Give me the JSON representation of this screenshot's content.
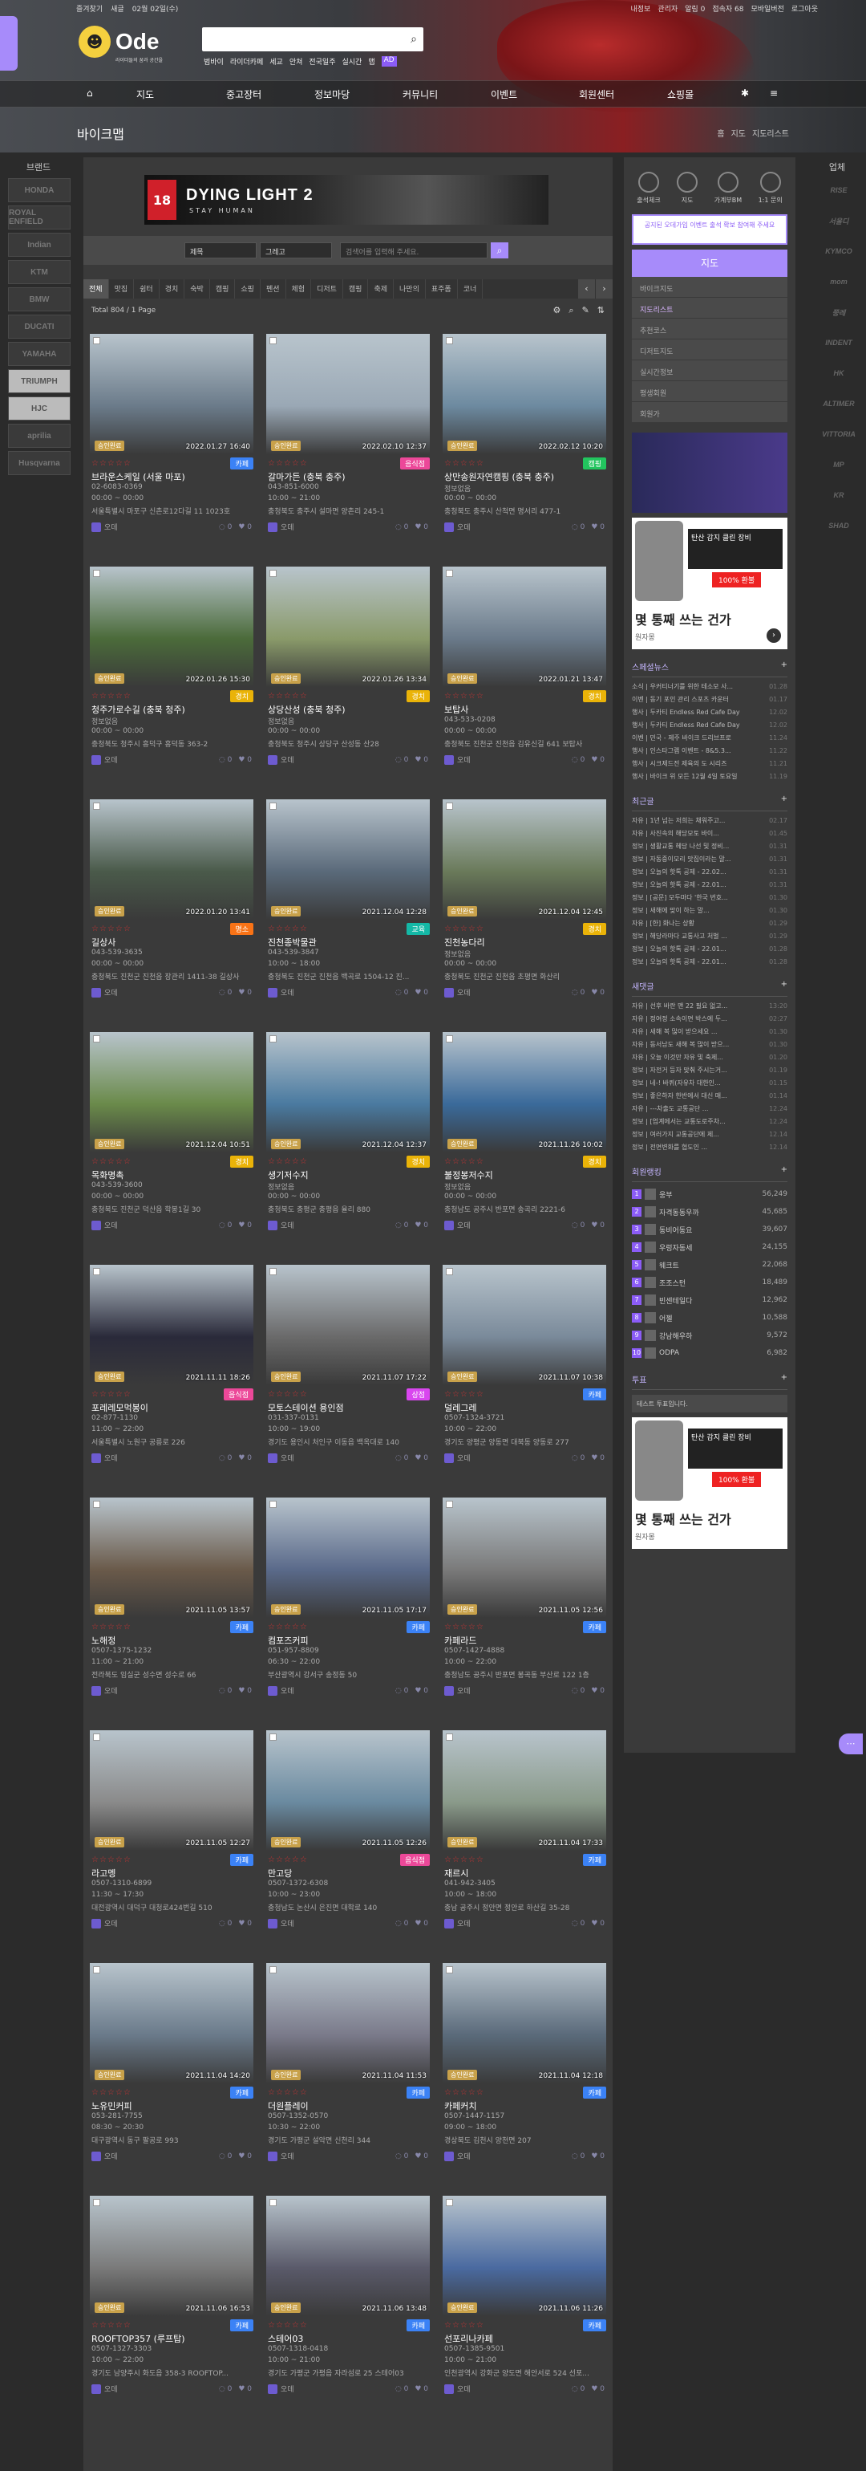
{
  "topbar": {
    "left": [
      "즐겨찾기",
      "새글",
      "02월 02일(수)"
    ],
    "right": [
      "내정보",
      "관리자",
      "알림 0",
      "접속자 68",
      "모바일버전",
      "로그아웃"
    ]
  },
  "logo": {
    "text": "Ode",
    "sub": "라이더들의 꿈과 공간을"
  },
  "search": {
    "placeholder": ""
  },
  "subnav": [
    "범바이",
    "라이더카페",
    "세교",
    "안쳐",
    "전국일주",
    "실시간",
    "맵"
  ],
  "subnav_ad": "AD",
  "mainnav": [
    "지도",
    "중고장터",
    "정보마당",
    "커뮤니티",
    "이벤트",
    "회원센터",
    "쇼핑몰"
  ],
  "page": {
    "title": "바이크맵",
    "breadcrumb": [
      "홈",
      "지도",
      "지도리스트"
    ]
  },
  "brands_left": {
    "title": "브랜드",
    "items": [
      "HONDA",
      "ROYAL ENFIELD",
      "Indian",
      "KTM",
      "BMW",
      "DUCATI",
      "YAMAHA",
      "TRIUMPH",
      "HJC",
      "aprilia",
      "Husqvarna"
    ]
  },
  "brands_right": {
    "title": "업체",
    "items": [
      "RISE",
      "서울디",
      "KYMCO",
      "mom",
      "쭝레",
      "INDENT",
      "HK",
      "ALTIMER",
      "VITTORIA",
      "MP",
      "KR",
      "SHAD"
    ]
  },
  "ad": {
    "brand": "DYING LIGHT 2",
    "sub": "STAY HUMAN",
    "rating": "18"
  },
  "filter": {
    "sel1": "제목",
    "sel2": "그레고",
    "placeholder": "검색어를 입력해 주세요."
  },
  "tabs": [
    "전체",
    "맛집",
    "쉼터",
    "경치",
    "숙박",
    "캠핑",
    "쇼핑",
    "펜션",
    "체험",
    "디저트",
    "캠핑",
    "축제",
    "나만의",
    "표주폼",
    "코너"
  ],
  "total": "Total 804 / 1 Page",
  "cards": [
    {
      "name": "브라운스케일 (서울 마포)",
      "phone": "02-6083-0369",
      "time": "00:00 ~ 00:00",
      "addr": "서울특별시 마포구 신촌로12다길 11 1023호",
      "date": "2022.01.27 16:40",
      "cat": "카페",
      "cc": "#3b82f6",
      "ph": "#6b7b8a"
    },
    {
      "name": "갈마가든 (충북 충주)",
      "phone": "043-851-6000",
      "time": "10:00 ~ 21:00",
      "addr": "충청북도 충주시 설마면 양촌리 245-1",
      "date": "2022.02.10 12:37",
      "cat": "음식점",
      "cc": "#ec4899",
      "ph": "#9aa8b5"
    },
    {
      "name": "상만송원자연캠핑 (충북 충주)",
      "phone": "정보없음",
      "time": "00:00 ~ 00:00",
      "addr": "충청북도 충주시 산척면 명서리 477-1",
      "date": "2022.02.12 10:20",
      "cat": "캠핑",
      "cc": "#22c55e",
      "ph": "#6d8aa0"
    },
    {
      "name": "청주가로수길 (충북 청주)",
      "phone": "정보없음",
      "time": "00:00 ~ 00:00",
      "addr": "충청북도 청주시 흥덕구 흥덕동 363-2",
      "date": "2022.01.26 15:30",
      "cat": "경치",
      "cc": "#eab308",
      "ph": "#4b6b3a"
    },
    {
      "name": "상당산성 (충북 청주)",
      "phone": "정보없음",
      "time": "00:00 ~ 00:00",
      "addr": "충청북도 청주시 상당구 산성동 산28",
      "date": "2022.01.26 13:34",
      "cat": "경치",
      "cc": "#eab308",
      "ph": "#8a9a6a"
    },
    {
      "name": "보탑사",
      "phone": "043-533-0208",
      "time": "00:00 ~ 00:00",
      "addr": "충청북도 진천군 진천읍 김유신길 641 보탑사",
      "date": "2022.01.21 13:47",
      "cat": "경치",
      "cc": "#eab308",
      "ph": "#6a7a8a"
    },
    {
      "name": "길상사",
      "phone": "043-539-3635",
      "time": "00:00 ~ 00:00",
      "addr": "충청북도 진천군 진천읍 장관리 1411-38 길상사",
      "date": "2022.01.20 13:41",
      "cat": "명소",
      "cc": "#f97316",
      "ph": "#4a5a4a"
    },
    {
      "name": "진천종박물관",
      "phone": "043-539-3847",
      "time": "10:00 ~ 18:00",
      "addr": "충청북도 진천군 진천읍 백곡로 1504-12 진...",
      "date": "2021.12.04 12:28",
      "cat": "교육",
      "cc": "#14b8a6",
      "ph": "#5a6a7a"
    },
    {
      "name": "진천농다리",
      "phone": "정보없음",
      "time": "00:00 ~ 00:00",
      "addr": "충청북도 진천군 진천읍 초평면 화산리",
      "date": "2021.12.04 12:45",
      "cat": "경치",
      "cc": "#eab308",
      "ph": "#6a7a5a"
    },
    {
      "name": "목화명촉",
      "phone": "043-539-3600",
      "time": "00:00 ~ 00:00",
      "addr": "충청북도 진천군 덕산읍 학봉1길 30",
      "date": "2021.12.04 10:51",
      "cat": "경치",
      "cc": "#eab308",
      "ph": "#6a8a4a"
    },
    {
      "name": "생기저수지",
      "phone": "정보없음",
      "time": "00:00 ~ 00:00",
      "addr": "충청북도 충평군 충평읍 율리 880",
      "date": "2021.12.04 12:37",
      "cat": "경치",
      "cc": "#eab308",
      "ph": "#4a7aa0"
    },
    {
      "name": "불정봉저수지",
      "phone": "정보없음",
      "time": "00:00 ~ 00:00",
      "addr": "충청남도 공주시 반포면 송곡리 2221-6",
      "date": "2021.11.26 10:02",
      "cat": "경치",
      "cc": "#eab308",
      "ph": "#3a6a9a"
    },
    {
      "name": "포레레모먹봉이",
      "phone": "02-877-1130",
      "time": "11:00 ~ 22:00",
      "addr": "서울특별시 노원구 공릉로 226",
      "date": "2021.11.11 18:26",
      "cat": "음식점",
      "cc": "#ec4899",
      "ph": "#2a2a3a"
    },
    {
      "name": "모토스테이션 용인점",
      "phone": "031-337-0131",
      "time": "10:00 ~ 19:00",
      "addr": "경기도 용인시 처인구 이동읍 백옥대로 140",
      "date": "2021.11.07 17:22",
      "cat": "상점",
      "cc": "#d946ef",
      "ph": "#6a6a6a"
    },
    {
      "name": "덜레그레",
      "phone": "0507-1324-3721",
      "time": "10:00 ~ 22:00",
      "addr": "경기도 양평군 양동면 대북동 양동로 277",
      "date": "2021.11.07 10:38",
      "cat": "카페",
      "cc": "#3b82f6",
      "ph": "#7a8a9a"
    },
    {
      "name": "노해정",
      "phone": "0507-1375-1232",
      "time": "11:00 ~ 21:00",
      "addr": "전라북도 임실군 성수면 성수로 66",
      "date": "2021.11.05 13:57",
      "cat": "카페",
      "cc": "#3b82f6",
      "ph": "#6a5a4a"
    },
    {
      "name": "컴포즈커피",
      "phone": "051-957-8809",
      "time": "06:30 ~ 22:00",
      "addr": "부산광역시 강서구 송정동 50",
      "date": "2021.11.05 17:17",
      "cat": "카페",
      "cc": "#3b82f6",
      "ph": "#5a6a8a"
    },
    {
      "name": "카페라드",
      "phone": "0507-1427-4888",
      "time": "10:00 ~ 22:00",
      "addr": "충청남도 공주시 반포면 봉곡동 부산로 122 1층",
      "date": "2021.11.05 12:56",
      "cat": "카페",
      "cc": "#3b82f6",
      "ph": "#7a7a7a"
    },
    {
      "name": "라고멩",
      "phone": "0507-1310-6899",
      "time": "11:30 ~ 17:30",
      "addr": "대전광역시 대덕구 대청로424번길 510",
      "date": "2021.11.05 12:27",
      "cat": "카페",
      "cc": "#3b82f6",
      "ph": "#8a8a8a"
    },
    {
      "name": "만고당",
      "phone": "0507-1372-6308",
      "time": "10:00 ~ 23:00",
      "addr": "충청남도 논산시 은진면 대학로 140",
      "date": "2021.11.05 12:26",
      "cat": "음식점",
      "cc": "#ec4899",
      "ph": "#6a8aa0"
    },
    {
      "name": "재르시",
      "phone": "041-942-3405",
      "time": "10:00 ~ 18:00",
      "addr": "충남 공주시 정안면 정안로 하산길 35-28",
      "date": "2021.11.04 17:33",
      "cat": "카페",
      "cc": "#3b82f6",
      "ph": "#8a9a8a"
    },
    {
      "name": "노유민커피",
      "phone": "053-281-7755",
      "time": "08:30 ~ 20:30",
      "addr": "대구광역시 동구 팔공로 993",
      "date": "2021.11.04 14:20",
      "cat": "카페",
      "cc": "#3b82f6",
      "ph": "#6a7a8a"
    },
    {
      "name": "더원플레이",
      "phone": "0507-1352-0570",
      "time": "10:30 ~ 22:00",
      "addr": "경기도 가평군 설악면 신천리 344",
      "date": "2021.11.04 11:53",
      "cat": "카페",
      "cc": "#3b82f6",
      "ph": "#7a7a8a"
    },
    {
      "name": "카페커치",
      "phone": "0507-1447-1157",
      "time": "09:00 ~ 18:00",
      "addr": "경상북도 김천시 양천면 207",
      "date": "2021.11.04 12:18",
      "cat": "카페",
      "cc": "#3b82f6",
      "ph": "#5a6a7a"
    },
    {
      "name": "ROOFTOP357 (루프탑)",
      "phone": "0507-1327-3303",
      "time": "10:00 ~ 22:00",
      "addr": "경기도 남양주시 화도읍 358-3 ROOFTOP...",
      "date": "2021.11.06 16:53",
      "cat": "카페",
      "cc": "#3b82f6",
      "ph": "#7a7a7a"
    },
    {
      "name": "스테어03",
      "phone": "0507-1318-0418",
      "time": "10:00 ~ 21:00",
      "addr": "경기도 가평군 가평읍 자라섬로 25 스테어03",
      "date": "2021.11.06 13:48",
      "cat": "카페",
      "cc": "#3b82f6",
      "ph": "#5a5a6a"
    },
    {
      "name": "선포리나카페",
      "phone": "0507-1385-9501",
      "time": "10:00 ~ 21:00",
      "addr": "인천광역시 강화군 양도면 해안서로 524 선포...",
      "date": "2021.11.06 11:26",
      "cat": "카페",
      "cc": "#3b82f6",
      "ph": "#4a6aa0"
    }
  ],
  "rpanel": {
    "quick": [
      "출석체크",
      "지도",
      "가계부BM",
      "1:1 문의"
    ],
    "notice": "공지된 오데가입 이벤트 출석 확보 참여해 주세요",
    "menu_title": "지도",
    "menu": [
      "바이크지도",
      "지도리스트",
      "추천코스",
      "디저트지도",
      "실시간정보",
      "평생회원",
      "회원가"
    ],
    "menu_active": 1,
    "ad2": {
      "headline": "탄산 감지 클린 장비",
      "btn": "100% 환불",
      "big": "몇 통째 쓰는 건가",
      "brand": "원자몽",
      "cc": "WANGEA"
    },
    "sec1": {
      "title": "스페셜뉴스",
      "rows": [
        [
          "소식 | 우커티너기를 위한 테소모 사...",
          "01.28"
        ],
        [
          "이벤 | 동기 포인 관리 스포츠 카운터",
          "01.17"
        ],
        [
          "행사 | 두카티 Endless Red Cafe Day",
          "12.02"
        ],
        [
          "행사 | 두카티 Endless Red Cafe Day",
          "12.02"
        ],
        [
          "이벤 | 민국 - 제주 바이크 드리브프로",
          "11.24"
        ],
        [
          "행사 | 인스타그램 이벤트 - 8&5.3...",
          "11.22"
        ],
        [
          "행사 | 시크제드전 제육의 도 시리즈",
          "11.21"
        ],
        [
          "행사 | 바이크 위 모든 12월 4일 토요일",
          "11.19"
        ]
      ]
    },
    "sec2": {
      "title": "최근글",
      "rows": [
        [
          "자유 | 1년 넘는 저희는 채워주고...",
          "02.17"
        ],
        [
          "자유 | 사진속의 해당모토 바이...",
          "01.45"
        ],
        [
          "정보 | 생활교통 헤당 나선 및 정비...",
          "01.31"
        ],
        [
          "정보 | 자동중이모리 맛집이라는 말...",
          "01.31"
        ],
        [
          "정보 | 오늘의 핫톡 공제 - 22.02...",
          "01.31"
        ],
        [
          "정보 | 오늘의 핫톡 공제 - 22.01...",
          "01.31"
        ],
        [
          "정보 | [공문] 모두마다 '한국 번호...",
          "01.30"
        ],
        [
          "정보 | 새해에 맞이 하는 말...",
          "01.30"
        ],
        [
          "자유 | [한] 화나는 상황",
          "01.29"
        ],
        [
          "정보 | 해당라마다 교통사고 처벌 ...",
          "01.29"
        ],
        [
          "정보 | 오늘의 핫톡 공제 - 22.01...",
          "01.28"
        ],
        [
          "정보 | 오늘의 핫톡 공제 - 22.01...",
          "01.28"
        ]
      ]
    },
    "sec3": {
      "title": "새댓글",
      "rows": [
        [
          "자유 | 선후 바란 맨 22 필요 없고...",
          "13:20"
        ],
        [
          "자유 | 정여정 소속이면 박스에 두...",
          "02:27"
        ],
        [
          "자유 | 새해 복 많이 받으세요 ...",
          "01.30"
        ],
        [
          "자유 | 동서남도 새해 복 많이 받으...",
          "01.30"
        ],
        [
          "자유 | 오늘 이것만 자유 및 축제...",
          "01.20"
        ],
        [
          "정보 | 자전거 등자 맞춰 주시는거...",
          "01.19"
        ],
        [
          "정보 | 네-! 바퀴(자유차 대한인...",
          "01.15"
        ],
        [
          "정보 | 좋은하자 한반에서 대신 매...",
          "01.14"
        ],
        [
          "자유 | ---차출도 교통공단 ...",
          "12.24"
        ],
        [
          "정보 | [업계에서는 교통도로주차...",
          "12.24"
        ],
        [
          "정보 | 여러가지 교통공단에 제...",
          "12.14"
        ],
        [
          "정보 | 전면변화를 협도인 ...",
          "12.14"
        ]
      ]
    },
    "sec4": {
      "title": "회원랭킹",
      "rows": [
        [
          "웅부",
          "56,249"
        ],
        [
          "자격동동우까",
          "45,685"
        ],
        [
          "동비어동요",
          "39,607"
        ],
        [
          "우렁자동세",
          "24,155"
        ],
        [
          "웨크트",
          "22,068"
        ],
        [
          "조조스턴",
          "18,489"
        ],
        [
          "빈센테일다",
          "12,962"
        ],
        [
          "어젤",
          "10,588"
        ],
        [
          "강남해우하",
          "9,572"
        ],
        [
          "ODPA",
          "6,982"
        ]
      ]
    },
    "poll_title": "투표",
    "poll": "테스트 투표입니다."
  }
}
